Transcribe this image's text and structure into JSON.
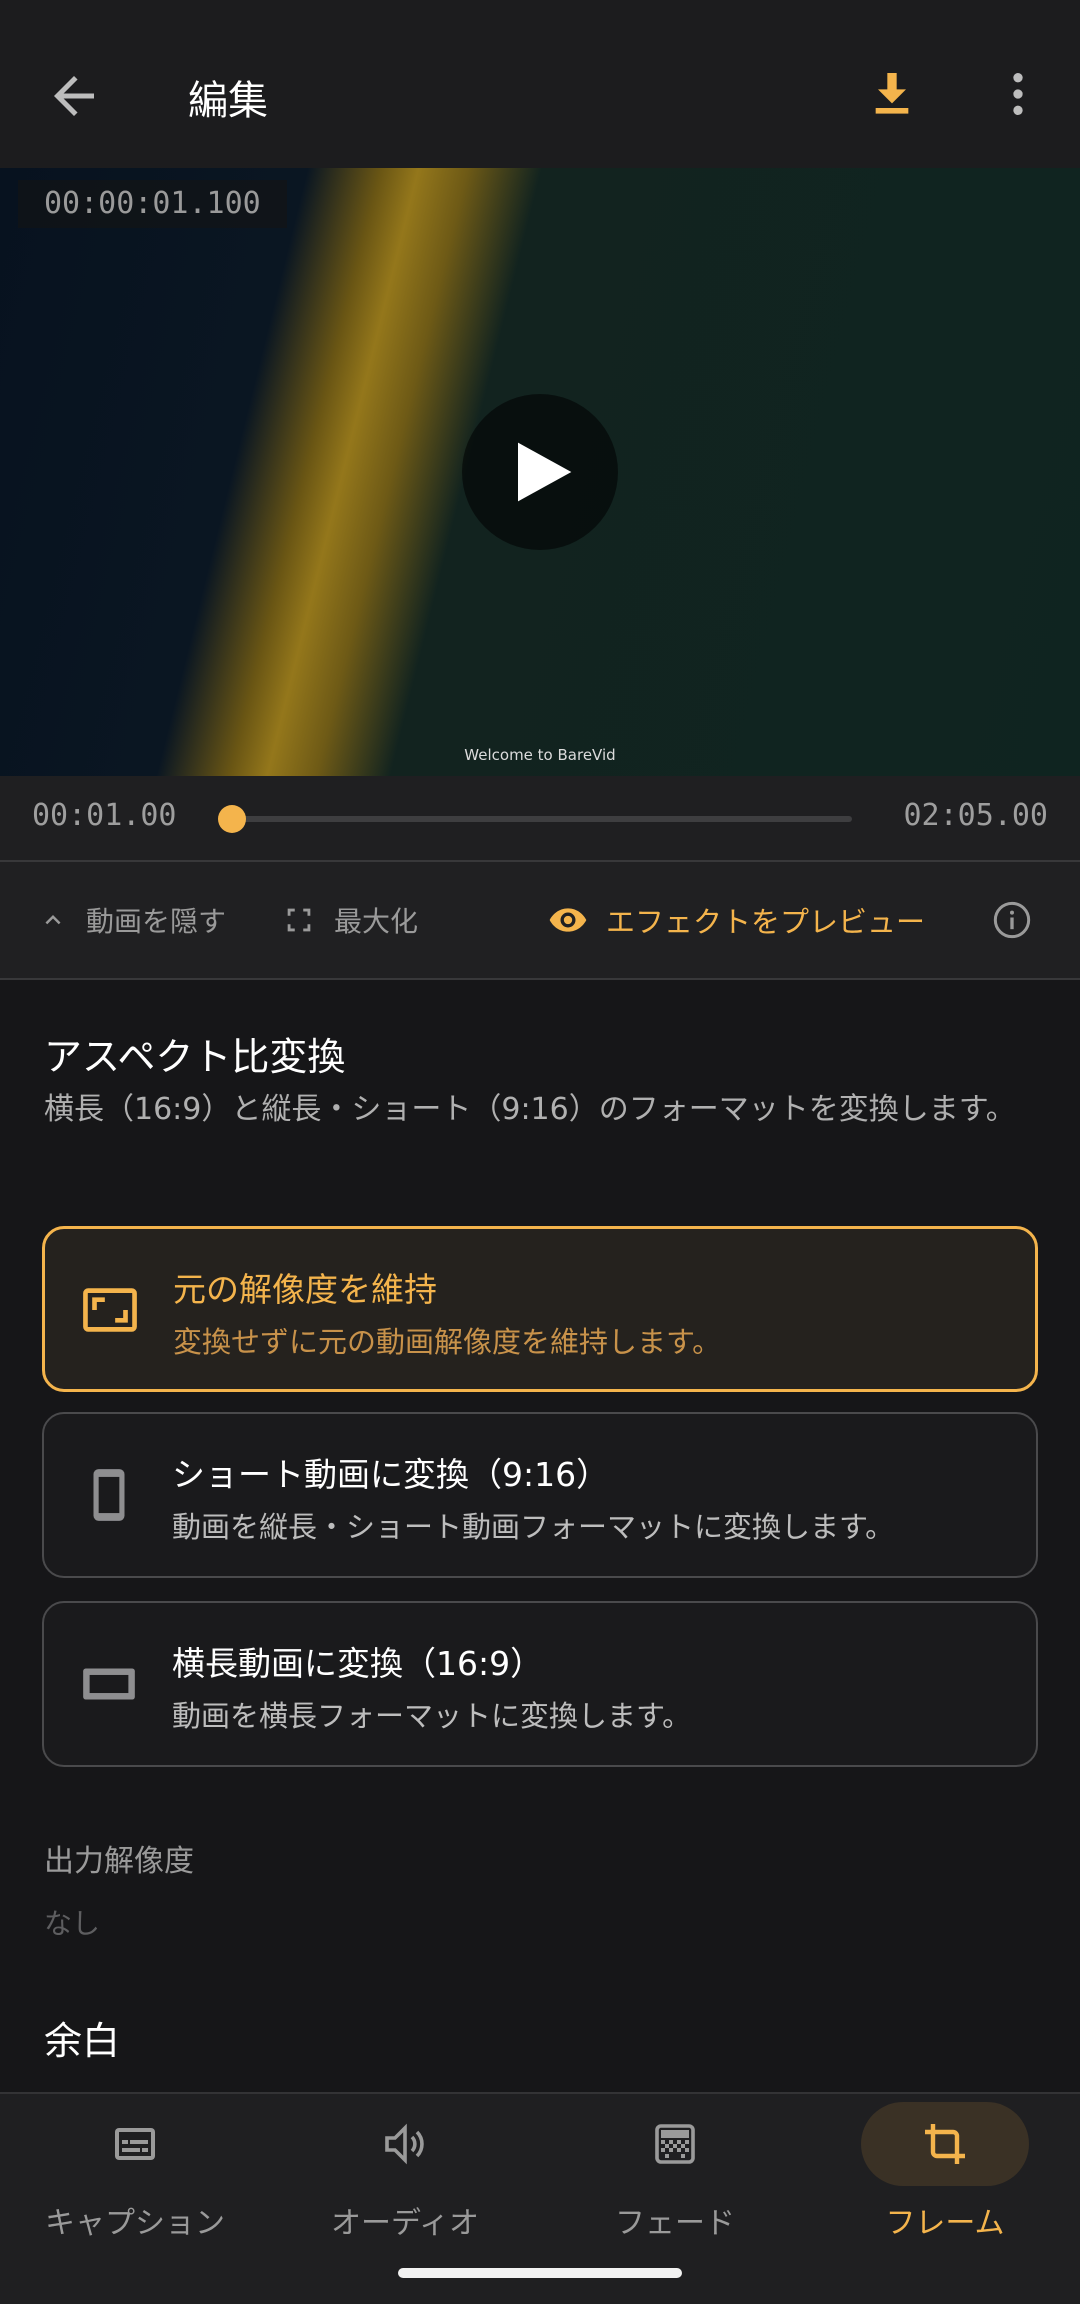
{
  "appbar": {
    "title": "編集",
    "icons": [
      "back-arrow-icon",
      "download-icon",
      "more-vert-icon"
    ]
  },
  "video": {
    "timecode": "00:00:01.100",
    "watermark": "Welcome to BareVid"
  },
  "scrubber": {
    "current": "00:01.00",
    "duration": "02:05.00",
    "progress": 0.008
  },
  "controls": {
    "hide_video": "動画を隠す",
    "maximize": "最大化",
    "preview_effects": "エフェクトをプレビュー"
  },
  "aspect": {
    "title": "アスペクト比変換",
    "description": "横長（16:9）と縦長・ショート（9:16）のフォーマットを変換します。",
    "options": [
      {
        "title": "元の解像度を維持",
        "desc": "変換せずに元の動画解像度を維持します。",
        "icon": "aspect-ratio-icon",
        "selected": true
      },
      {
        "title": "ショート動画に変換（9:16）",
        "desc": "動画を縦長・ショート動画フォーマットに変換します。",
        "icon": "phone-portrait-icon",
        "selected": false
      },
      {
        "title": "横長動画に変換（16:9）",
        "desc": "動画を横長フォーマットに変換します。",
        "icon": "landscape-rect-icon",
        "selected": false
      }
    ]
  },
  "output": {
    "label": "出力解像度",
    "value": "なし"
  },
  "margin": {
    "title": "余白"
  },
  "nav": {
    "items": [
      {
        "label": "キャプション",
        "icon": "subtitles-icon"
      },
      {
        "label": "オーディオ",
        "icon": "volume-icon"
      },
      {
        "label": "フェード",
        "icon": "fade-icon"
      },
      {
        "label": "フレーム",
        "icon": "crop-icon",
        "active": true
      }
    ]
  },
  "colors": {
    "accent": "#f4b44c",
    "background": "#161618"
  }
}
